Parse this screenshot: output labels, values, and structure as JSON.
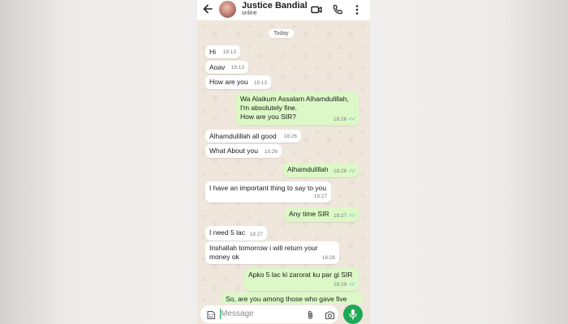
{
  "header": {
    "contact_name": "Justice Bandial",
    "status": "online"
  },
  "chat": {
    "date_label": "Today",
    "messages": [
      {
        "text": "Hi",
        "time": "18:13",
        "direction": "in"
      },
      {
        "text": "Aoav",
        "time": "18:13",
        "direction": "in"
      },
      {
        "text": "How are you",
        "time": "18:13",
        "direction": "in"
      },
      {
        "text": "Wa Alaikum Assalam Alhamdulillah,\nI'm absolutely fine.\nHow are you SIR?",
        "time": "18:26",
        "direction": "out",
        "read": true
      },
      {
        "text": "Alhamdulillah all good",
        "time": "18:26",
        "direction": "in"
      },
      {
        "text": "What About you",
        "time": "18:26",
        "direction": "in"
      },
      {
        "text": "Alhamdulillah",
        "time": "18:26",
        "direction": "out",
        "read": true
      },
      {
        "text": "I have an important thing to say to you",
        "time": "18:27",
        "direction": "in"
      },
      {
        "text": "Any time SIR",
        "time": "18:27",
        "direction": "out",
        "read": true
      },
      {
        "text": "I need 5 lac",
        "time": "18:27",
        "direction": "in"
      },
      {
        "text": "Inshallah tomorrow i will return your\nmoney ok",
        "time": "18:28",
        "direction": "in"
      },
      {
        "text": "Apko 5 lac ki zarorat ku par gi SIR",
        "time": "18:29",
        "direction": "out",
        "read": true
      },
      {
        "text": "So, are you among those who gave five",
        "time": "",
        "direction": "out"
      }
    ]
  },
  "composer": {
    "placeholder": "Message"
  },
  "icons": {
    "back": "arrow-left-icon",
    "video": "video-call-icon",
    "call": "phone-icon",
    "menu": "more-vertical-icon",
    "emoji": "emoji-icon",
    "attach": "paperclip-icon",
    "camera": "camera-icon",
    "mic": "microphone-icon"
  },
  "colors": {
    "incoming_bubble": "#ffffff",
    "outgoing_bubble": "#dcf8c6",
    "chat_background": "#efe7dc",
    "read_ticks": "#4fb6ec",
    "accent": "#1fa855"
  }
}
